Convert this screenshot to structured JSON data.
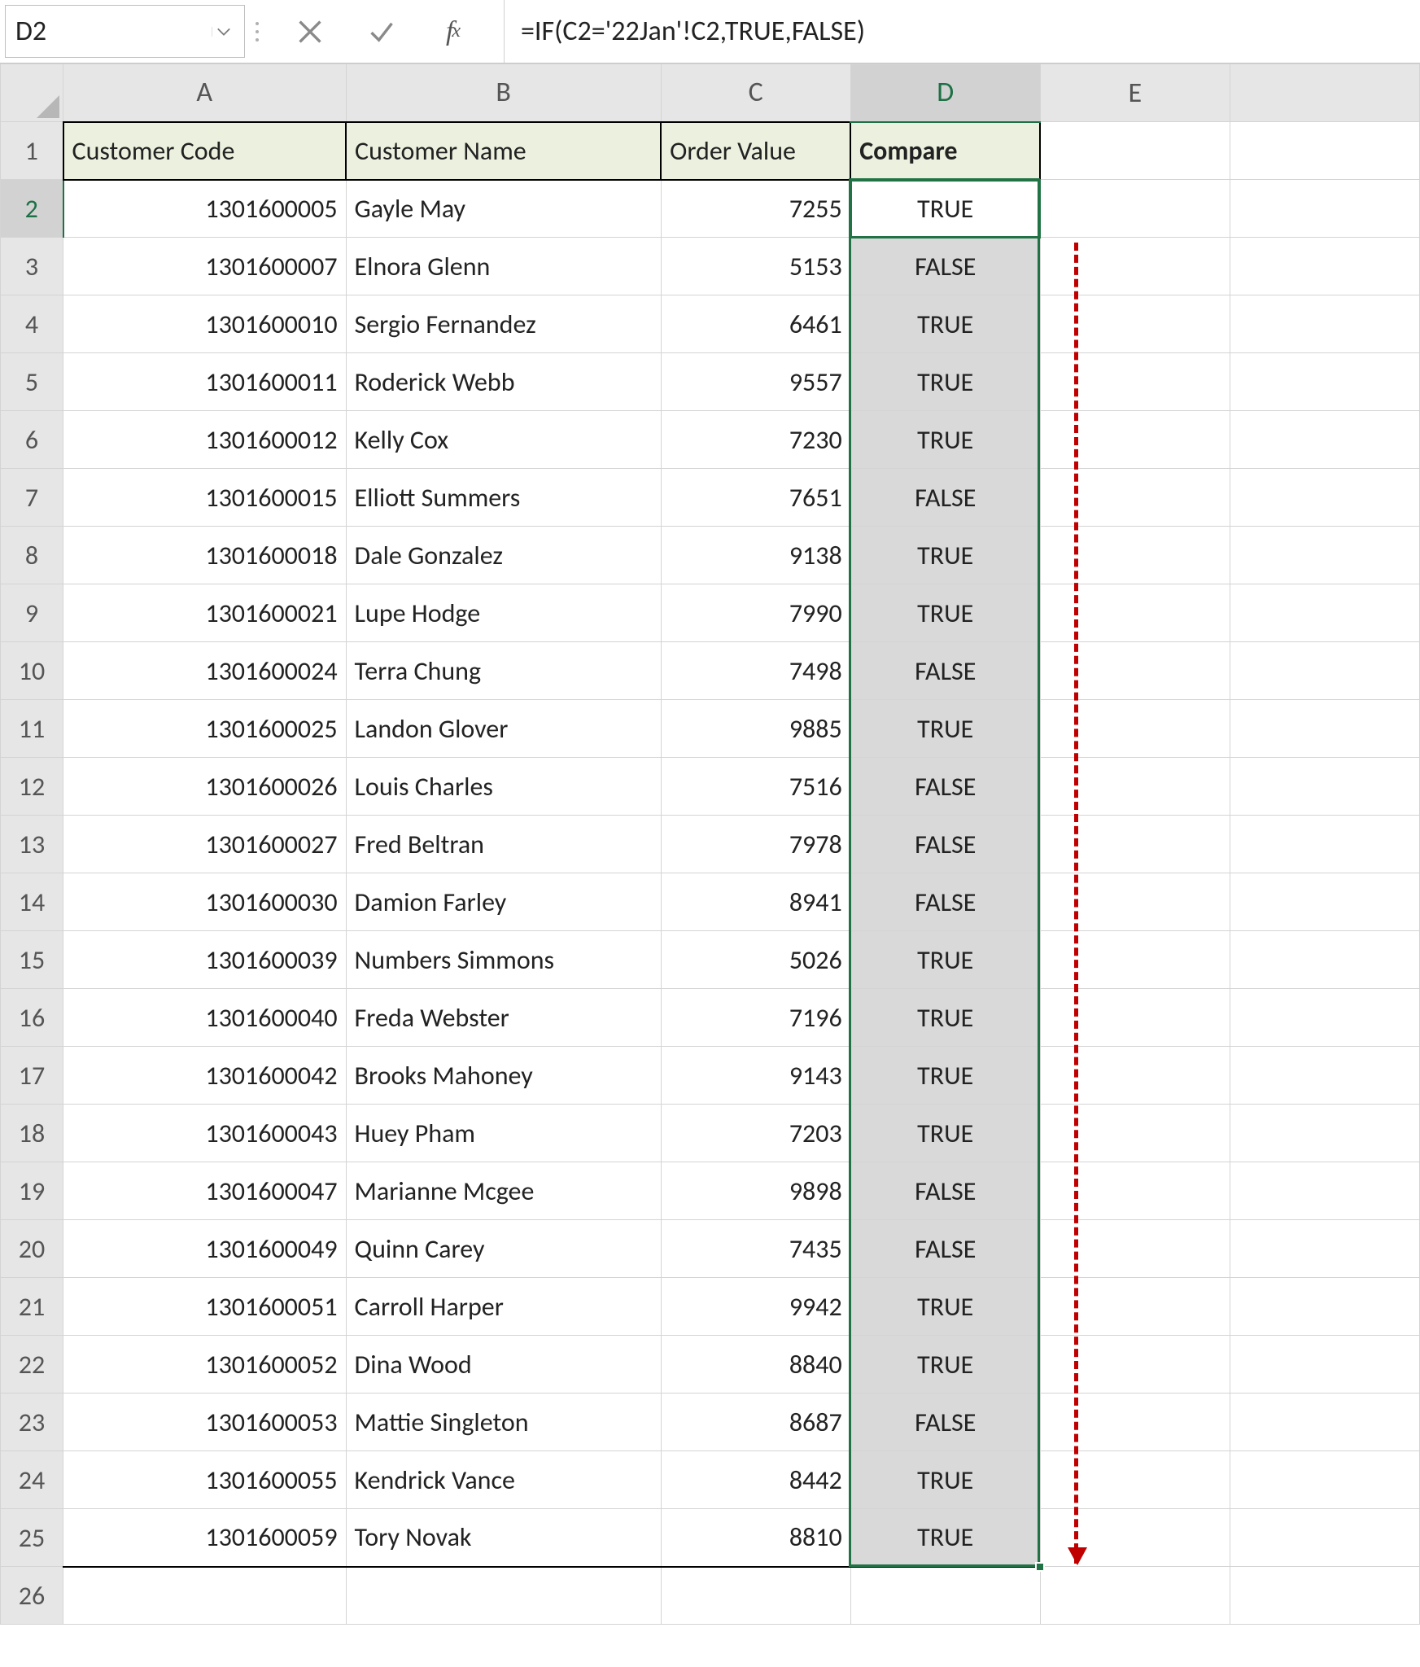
{
  "namebox": {
    "value": "D2"
  },
  "formula": {
    "value": "=IF(C2='22Jan'!C2,TRUE,FALSE)"
  },
  "columns": [
    "A",
    "B",
    "C",
    "D",
    "E"
  ],
  "active_column": "D",
  "active_row": 2,
  "headers": {
    "A": "Customer Code",
    "B": "Customer Name",
    "C": "Order Value",
    "D": "Compare"
  },
  "rows": [
    {
      "n": 2,
      "code": "1301600005",
      "name": "Gayle May",
      "value": "7255",
      "cmp": "TRUE"
    },
    {
      "n": 3,
      "code": "1301600007",
      "name": "Elnora Glenn",
      "value": "5153",
      "cmp": "FALSE"
    },
    {
      "n": 4,
      "code": "1301600010",
      "name": "Sergio Fernandez",
      "value": "6461",
      "cmp": "TRUE"
    },
    {
      "n": 5,
      "code": "1301600011",
      "name": "Roderick Webb",
      "value": "9557",
      "cmp": "TRUE"
    },
    {
      "n": 6,
      "code": "1301600012",
      "name": "Kelly Cox",
      "value": "7230",
      "cmp": "TRUE"
    },
    {
      "n": 7,
      "code": "1301600015",
      "name": "Elliott Summers",
      "value": "7651",
      "cmp": "FALSE"
    },
    {
      "n": 8,
      "code": "1301600018",
      "name": "Dale Gonzalez",
      "value": "9138",
      "cmp": "TRUE"
    },
    {
      "n": 9,
      "code": "1301600021",
      "name": "Lupe Hodge",
      "value": "7990",
      "cmp": "TRUE"
    },
    {
      "n": 10,
      "code": "1301600024",
      "name": "Terra Chung",
      "value": "7498",
      "cmp": "FALSE"
    },
    {
      "n": 11,
      "code": "1301600025",
      "name": "Landon Glover",
      "value": "9885",
      "cmp": "TRUE"
    },
    {
      "n": 12,
      "code": "1301600026",
      "name": "Louis Charles",
      "value": "7516",
      "cmp": "FALSE"
    },
    {
      "n": 13,
      "code": "1301600027",
      "name": "Fred Beltran",
      "value": "7978",
      "cmp": "FALSE"
    },
    {
      "n": 14,
      "code": "1301600030",
      "name": "Damion Farley",
      "value": "8941",
      "cmp": "FALSE"
    },
    {
      "n": 15,
      "code": "1301600039",
      "name": "Numbers Simmons",
      "value": "5026",
      "cmp": "TRUE"
    },
    {
      "n": 16,
      "code": "1301600040",
      "name": "Freda Webster",
      "value": "7196",
      "cmp": "TRUE"
    },
    {
      "n": 17,
      "code": "1301600042",
      "name": "Brooks Mahoney",
      "value": "9143",
      "cmp": "TRUE"
    },
    {
      "n": 18,
      "code": "1301600043",
      "name": "Huey Pham",
      "value": "7203",
      "cmp": "TRUE"
    },
    {
      "n": 19,
      "code": "1301600047",
      "name": "Marianne Mcgee",
      "value": "9898",
      "cmp": "FALSE"
    },
    {
      "n": 20,
      "code": "1301600049",
      "name": "Quinn Carey",
      "value": "7435",
      "cmp": "FALSE"
    },
    {
      "n": 21,
      "code": "1301600051",
      "name": "Carroll Harper",
      "value": "9942",
      "cmp": "TRUE"
    },
    {
      "n": 22,
      "code": "1301600052",
      "name": "Dina Wood",
      "value": "8840",
      "cmp": "TRUE"
    },
    {
      "n": 23,
      "code": "1301600053",
      "name": "Mattie Singleton",
      "value": "8687",
      "cmp": "FALSE"
    },
    {
      "n": 24,
      "code": "1301600055",
      "name": "Kendrick Vance",
      "value": "8442",
      "cmp": "TRUE"
    },
    {
      "n": 25,
      "code": "1301600059",
      "name": "Tory Novak",
      "value": "8810",
      "cmp": "TRUE"
    }
  ],
  "extra_rows": [
    26
  ]
}
